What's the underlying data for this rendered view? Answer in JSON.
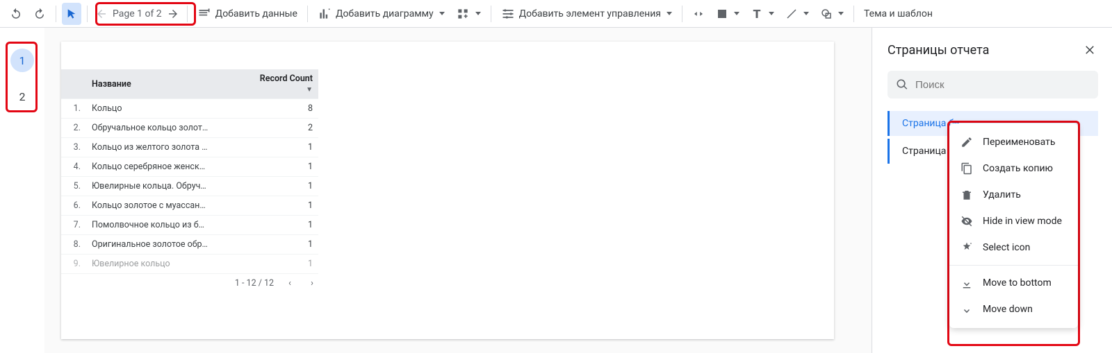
{
  "toolbar": {
    "page_nav_label": "Page 1 of 2",
    "add_data": "Добавить данные",
    "add_chart": "Добавить диаграмму",
    "add_control": "Добавить элемент управления",
    "theme": "Тема и шаблон"
  },
  "page_rail": {
    "items": [
      {
        "num": "1",
        "active": true
      },
      {
        "num": "2",
        "active": false
      }
    ]
  },
  "table": {
    "headers": {
      "idx": "",
      "name": "Название",
      "count": "Record Count"
    },
    "rows": [
      {
        "idx": "1.",
        "name": "Кольцо",
        "count": "8"
      },
      {
        "idx": "2.",
        "name": "Обручальное кольцо золот…",
        "count": "2"
      },
      {
        "idx": "3.",
        "name": "Кольцо из желтого золота …",
        "count": "1"
      },
      {
        "idx": "4.",
        "name": "Кольцо серебряное женск…",
        "count": "1"
      },
      {
        "idx": "5.",
        "name": "Ювелирные кольца. Обруч…",
        "count": "1"
      },
      {
        "idx": "6.",
        "name": "Кольцо золотое с муассан…",
        "count": "1"
      },
      {
        "idx": "7.",
        "name": "Помолвочное кольцо из б…",
        "count": "1"
      },
      {
        "idx": "8.",
        "name": "Оригинальное золотое обр…",
        "count": "1"
      },
      {
        "idx": "9.",
        "name": "Ювелирное кольцо",
        "count": "1"
      }
    ],
    "pager": "1 - 12 / 12"
  },
  "side_panel": {
    "title": "Страницы отчета",
    "search_placeholder": "Поиск",
    "pages": [
      {
        "label": "Страница бе",
        "selected": true
      },
      {
        "label": "Страница бе",
        "selected": false
      }
    ]
  },
  "context_menu": {
    "rename": "Переименовать",
    "duplicate": "Создать копию",
    "delete": "Удалить",
    "hide": "Hide in view mode",
    "select_icon": "Select icon",
    "move_bottom": "Move to bottom",
    "move_down": "Move down"
  }
}
